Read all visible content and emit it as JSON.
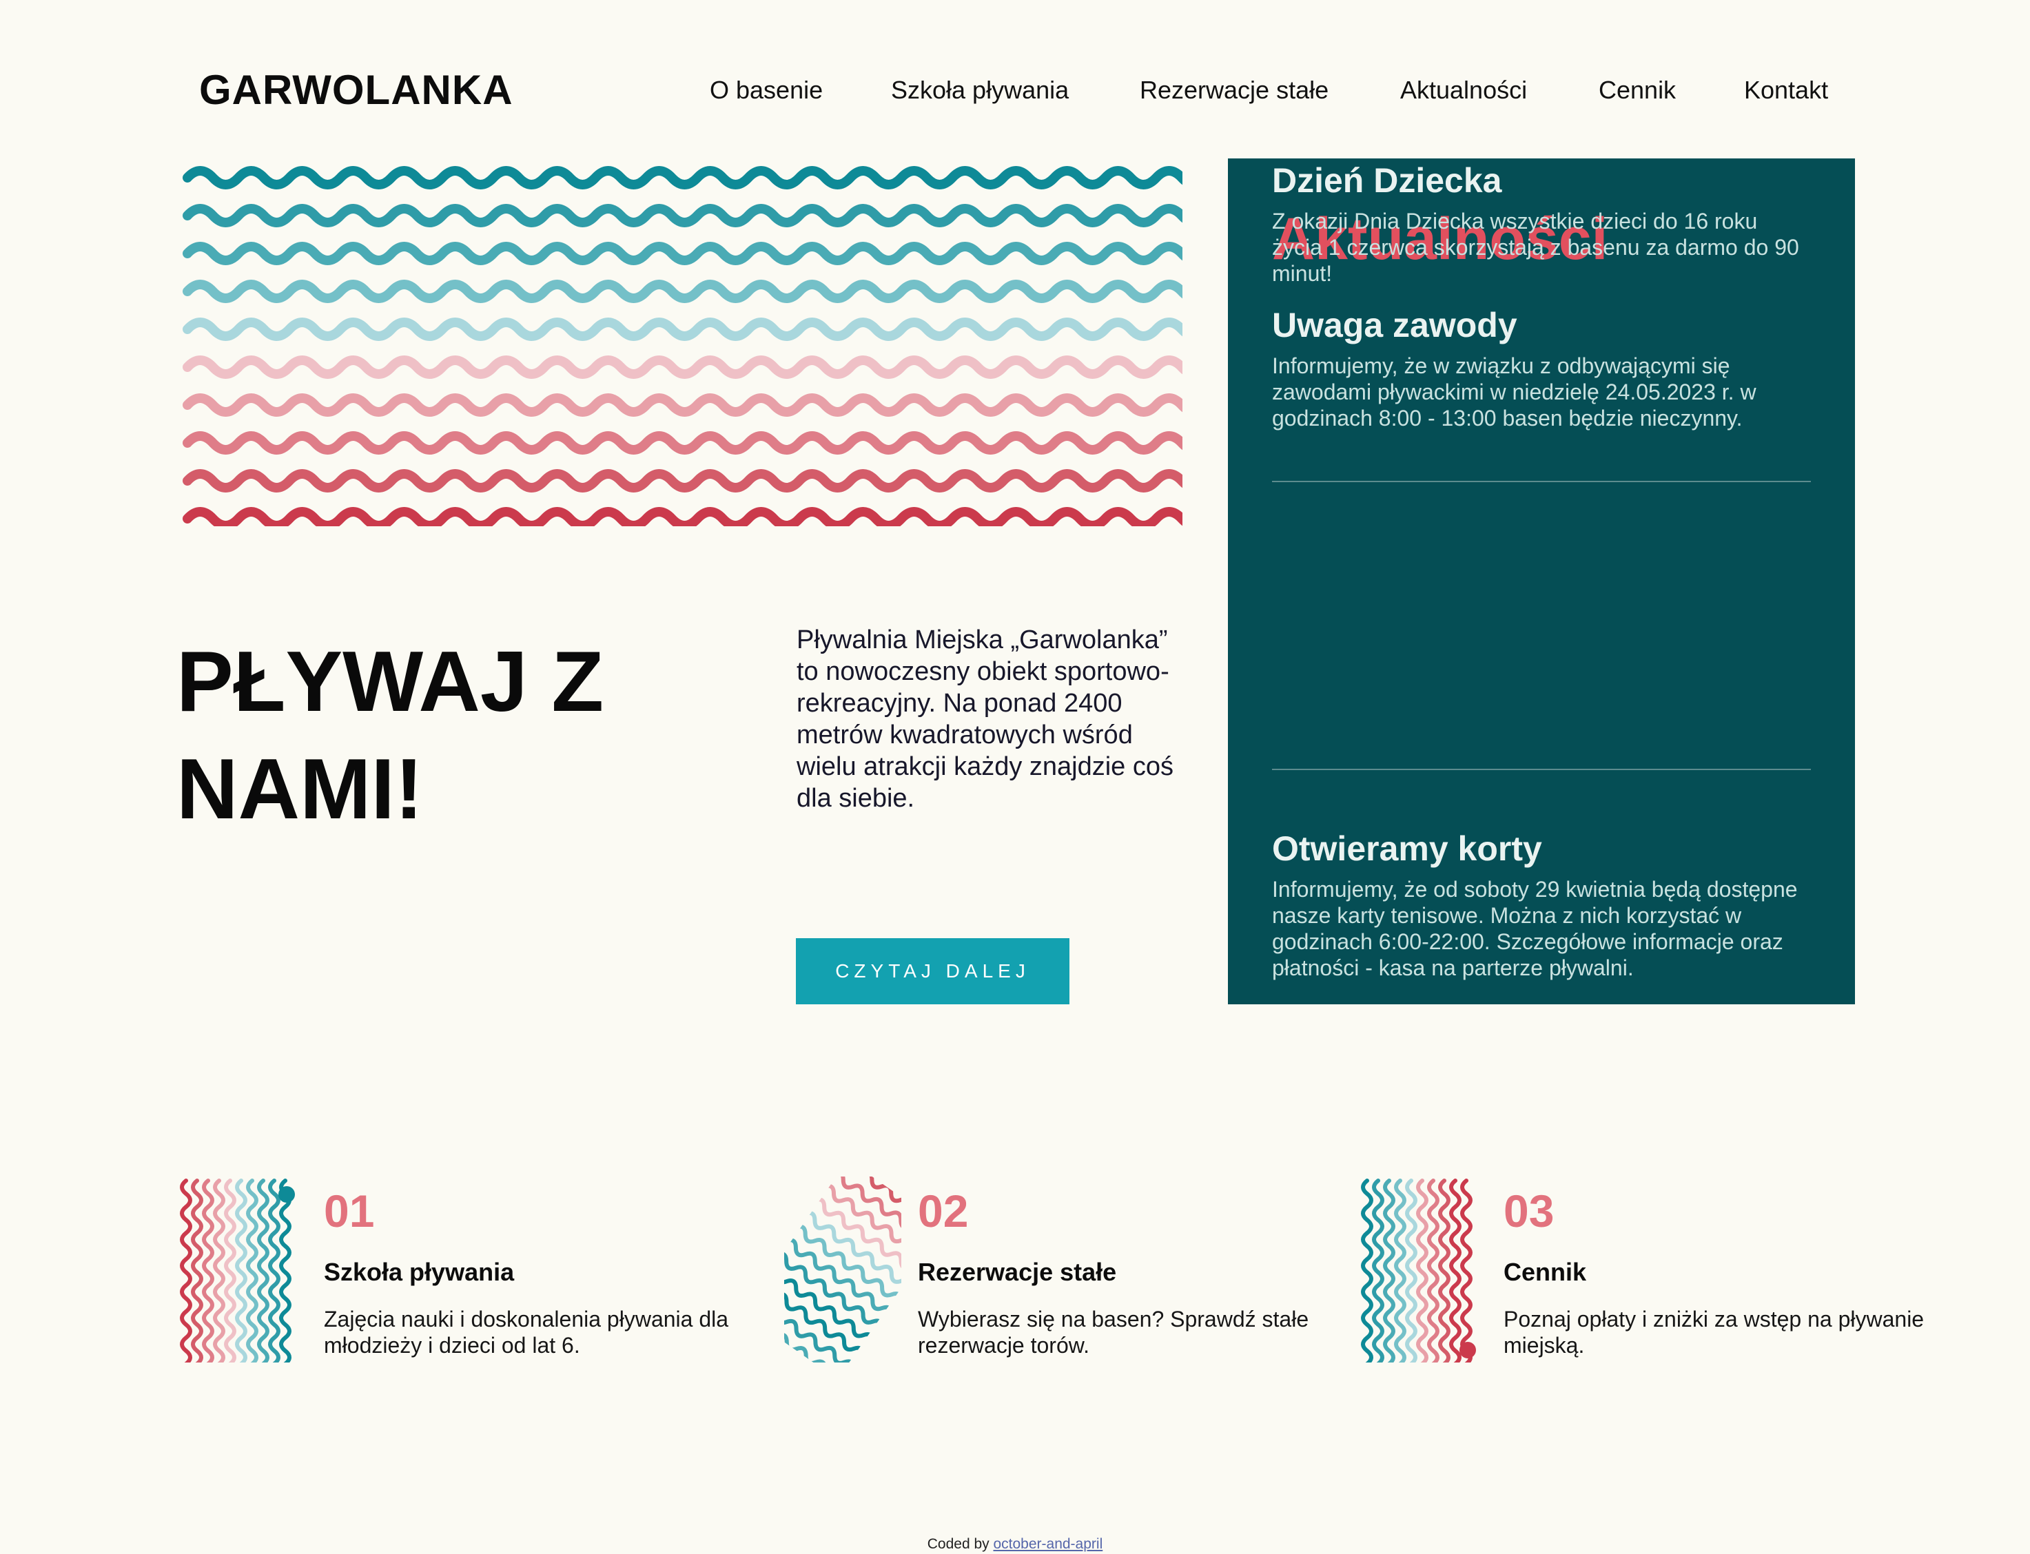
{
  "brand": "GARWOLANKA",
  "nav": [
    "O basenie",
    "Szkoła pływania",
    "Rezerwacje stałe",
    "Aktualności",
    "Cennik",
    "Kontakt"
  ],
  "hero": {
    "headline": "PŁYWAJ Z NAMI!",
    "intro": "Pływalnia Miejska „Garwolanka” to nowoczesny obiekt sportowo-rekreacyjny. Na ponad 2400 metrów kwadratowych wśród wielu atrakcji każdy znajdzie coś dla siebie.",
    "cta": "CZYTAJ DALEJ"
  },
  "news": {
    "heading": "Aktualności",
    "items": [
      {
        "title": "Uwaga zawody",
        "text": "Informujemy, że w związku z odbywającymi się zawodami pływackimi w niedzielę 24.05.2023 r. w godzinach 8:00 - 13:00 basen będzie nieczynny."
      },
      {
        "title": "Otwieramy korty",
        "text": "Informujemy, że od soboty 29 kwietnia będą dostępne nasze karty tenisowe. Można z nich korzystać w godzinach 6:00-22:00. Szczegółowe informacje oraz płatności - kasa na parterze pływalni."
      },
      {
        "title": "Dzień Dziecka",
        "text": "Z okazji Dnia Dziecka wszystkie dzieci do 16 roku życia 1 czerwca skorzystają z basenu za darmo do 90 minut!"
      }
    ]
  },
  "features": [
    {
      "number": "01",
      "title": "Szkoła pływania",
      "text": "Zajęcia nauki i doskonalenia pływania dla młodzieży i dzieci od lat 6."
    },
    {
      "number": "02",
      "title": "Rezerwacje stałe",
      "text": "Wybierasz się na basen? Sprawdź stałe rezerwacje torów."
    },
    {
      "number": "03",
      "title": "Cennik",
      "text": "Poznaj opłaty i zniżki za wstęp na pływanie miejską."
    }
  ],
  "footer": {
    "prefix": "Coded by",
    "link": "october-and-april"
  },
  "colors": {
    "background": "#fbfaf3",
    "panel": "#054e55",
    "accent_red": "#e2505e",
    "accent_teal": "#13a1b0",
    "wave_palette": [
      "#0e8a97",
      "#2f9ca8",
      "#4aabb5",
      "#74c0c8",
      "#a9d7dd",
      "#efc0c6",
      "#e8a0a8",
      "#df7d88",
      "#d45c69",
      "#cb3a4c"
    ]
  }
}
